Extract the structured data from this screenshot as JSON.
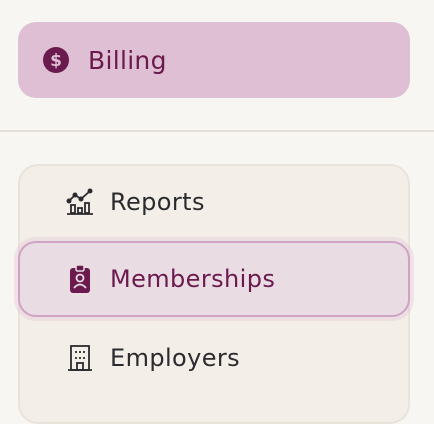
{
  "billing": {
    "label": "Billing",
    "icon": "dollar-circle-icon"
  },
  "nav": {
    "items": [
      {
        "label": "Reports",
        "icon": "chart-icon",
        "active": false
      },
      {
        "label": "Memberships",
        "icon": "id-badge-icon",
        "active": true
      },
      {
        "label": "Employers",
        "icon": "building-icon",
        "active": false
      }
    ]
  },
  "colors": {
    "accent": "#6b1a4e",
    "billing_bg": "#dfbfd3",
    "active_bg": "#eadce3",
    "active_border": "#cfa3c4",
    "panel_bg": "#f3efe8"
  }
}
